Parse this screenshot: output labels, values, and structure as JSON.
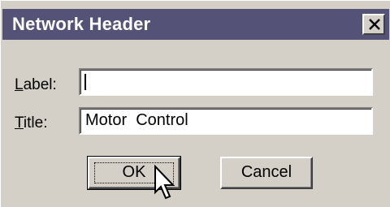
{
  "dialog": {
    "title": "Network Header",
    "close_icon": "close-x-icon"
  },
  "fields": {
    "label": {
      "mnemonic": "L",
      "rest": "abel:",
      "value": ""
    },
    "title": {
      "mnemonic": "T",
      "rest": "itle:",
      "value": "Motor  Control"
    }
  },
  "buttons": {
    "ok": "OK",
    "cancel": "Cancel"
  },
  "cursor": "arrow-pointer-icon"
}
